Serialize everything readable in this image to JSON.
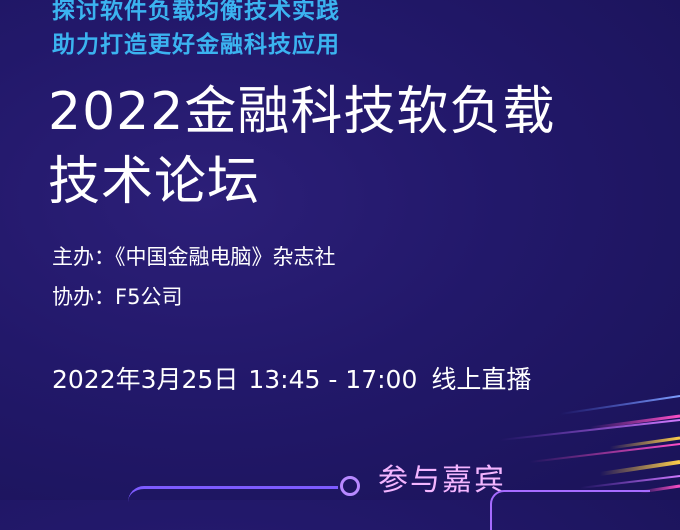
{
  "tagline": {
    "line1": "探讨软件负载均衡技术实践",
    "line2": "助力打造更好金融科技应用"
  },
  "title": {
    "line1": "2022金融科技软负载",
    "line2": "技术论坛"
  },
  "organizer": {
    "label": "主办：",
    "value": "《中国金融电脑》杂志社"
  },
  "coorganizer": {
    "label": "协办：",
    "value": "F5公司"
  },
  "event": {
    "date": "2022年3月25日",
    "time": "13:45 - 17:00",
    "format": "线上直播"
  },
  "cta": {
    "label": "参与嘉宾",
    "icon": "location-pin-icon"
  },
  "colors": {
    "background": "#22186a",
    "tagline": "#3bb3f0",
    "title": "#ffffff",
    "cta": "#f3b5ff",
    "accent_pink": "#ff4fc7",
    "accent_yellow": "#ffcf4a"
  }
}
